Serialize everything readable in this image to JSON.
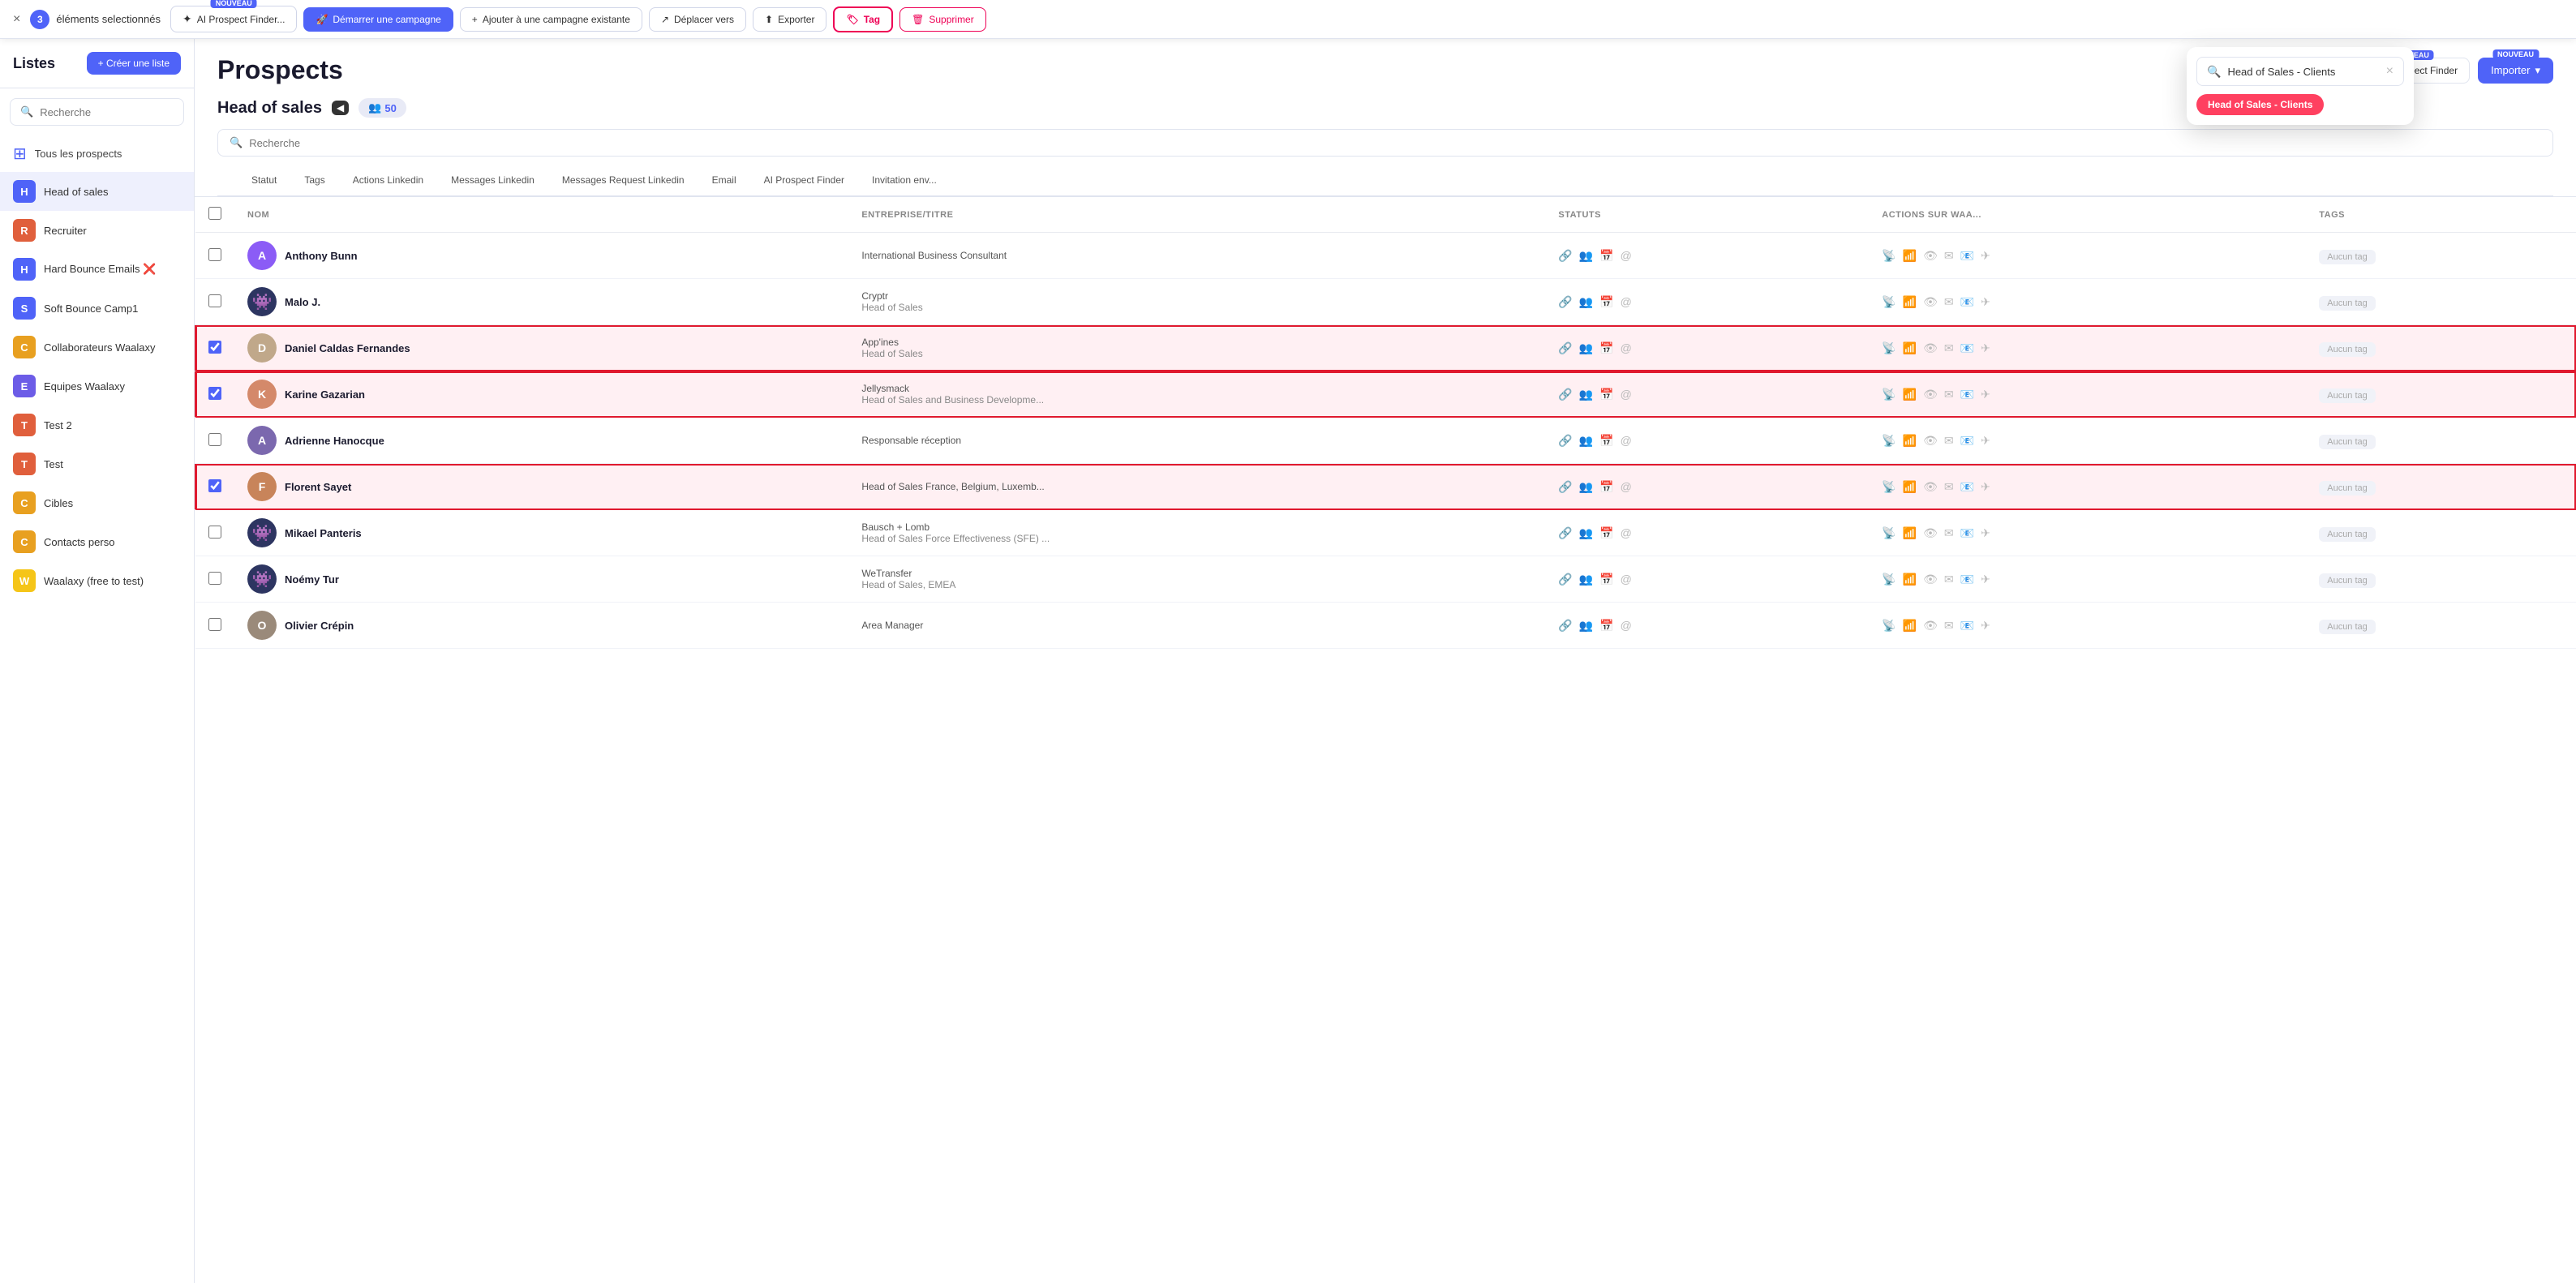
{
  "topbar": {
    "close_label": "×",
    "selected_count": "3",
    "selected_label": "éléments selectionnés",
    "ai_btn_label": "AI Prospect Finder...",
    "ai_btn_nouveau": "NOUVEAU",
    "campaign_btn": "Démarrer une campagne",
    "add_campaign_btn": "Ajouter à une campagne existante",
    "move_btn": "Déplacer vers",
    "export_btn": "Exporter",
    "tag_btn": "Tag",
    "delete_btn": "Supprimer"
  },
  "sidebar": {
    "title": "Listes",
    "create_btn": "+ Créer une liste",
    "search_placeholder": "Recherche",
    "all_label": "Tous les prospects",
    "lists": [
      {
        "id": "head-sales",
        "label": "Head of sales",
        "color": "#4f63f8",
        "letter": "H",
        "active": true
      },
      {
        "id": "recruiter",
        "label": "Recruiter",
        "color": "#e05f3c",
        "letter": "R"
      },
      {
        "id": "hard-bounce",
        "label": "Hard Bounce Emails ❌",
        "color": "#4f63f8",
        "letter": "H"
      },
      {
        "id": "soft-bounce",
        "label": "Soft Bounce Camp1",
        "color": "#4f63f8",
        "letter": "S"
      },
      {
        "id": "collaborateurs",
        "label": "Collaborateurs Waalaxy",
        "color": "#e8a020",
        "letter": "C"
      },
      {
        "id": "equipes",
        "label": "Equipes Waalaxy",
        "color": "#6c5ce7",
        "letter": "E"
      },
      {
        "id": "test2",
        "label": "Test 2",
        "color": "#e05f3c",
        "letter": "T"
      },
      {
        "id": "test",
        "label": "Test",
        "color": "#e05f3c",
        "letter": "T"
      },
      {
        "id": "cibles",
        "label": "Cibles",
        "color": "#e8a020",
        "letter": "C"
      },
      {
        "id": "contacts-perso",
        "label": "Contacts perso",
        "color": "#e8a020",
        "letter": "C"
      },
      {
        "id": "waalaxy-free",
        "label": "Waalaxy (free to test)",
        "color": "#f5c518",
        "letter": "W"
      }
    ]
  },
  "main": {
    "page_title": "Prospects",
    "list_name": "Head of sales",
    "count": "50",
    "count_icon": "👥",
    "search_placeholder": "Recherche",
    "import_btn": "Importer",
    "import_nouveau": "NOUVEAU",
    "prospect_finder_btn": "AI Prospect Finder",
    "prospect_finder_nouveau": "NOUVEAU",
    "filter_tabs": [
      "Statut",
      "Tags",
      "Actions Linkedin",
      "Messages Linkedin",
      "Messages Request Linkedin",
      "Email",
      "AI Prospect Finder",
      "Invitation env..."
    ],
    "table_headers": [
      "NOM",
      "ENTREPRISE/TITRE",
      "STATUTS",
      "ACTIONS SUR WAA...",
      "TAGS"
    ],
    "prospects": [
      {
        "id": 1,
        "name": "Anthony Bunn",
        "company": "International Business Consultant",
        "job": "",
        "selected": false,
        "avatar_type": "img",
        "avatar_bg": "#8b5cf6",
        "avatar_letter": "A"
      },
      {
        "id": 2,
        "name": "Malo J.",
        "company": "Cryptr",
        "job": "Head of Sales",
        "selected": false,
        "avatar_type": "alien",
        "avatar_bg": "#4f63f8"
      },
      {
        "id": 3,
        "name": "Daniel Caldas Fernandes",
        "company": "App'ines",
        "job": "Head of Sales",
        "selected": true,
        "avatar_type": "photo",
        "avatar_bg": "#c0a88a"
      },
      {
        "id": 4,
        "name": "Karine Gazarian",
        "company": "Jellysmack",
        "job": "Head of Sales and Business Developme...",
        "selected": true,
        "avatar_type": "photo",
        "avatar_bg": "#d4896a"
      },
      {
        "id": 5,
        "name": "Adrienne Hanocque",
        "company": "Responsable réception",
        "job": "",
        "selected": false,
        "avatar_type": "photo",
        "avatar_bg": "#7b68ae"
      },
      {
        "id": 6,
        "name": "Florent Sayet",
        "company": "Head of Sales France, Belgium, Luxemb...",
        "job": "",
        "selected": true,
        "avatar_type": "photo",
        "avatar_bg": "#c8845a"
      },
      {
        "id": 7,
        "name": "Mikael Panteris",
        "company": "Bausch + Lomb",
        "job": "Head of Sales Force Effectiveness (SFE) ...",
        "selected": false,
        "avatar_type": "alien",
        "avatar_bg": "#4f63f8"
      },
      {
        "id": 8,
        "name": "Noémy Tur",
        "company": "WeTransfer",
        "job": "Head of Sales, EMEA",
        "selected": false,
        "avatar_type": "alien",
        "avatar_bg": "#4f63f8"
      },
      {
        "id": 9,
        "name": "Olivier Crépin",
        "company": "Area Manager",
        "job": "",
        "selected": false,
        "avatar_type": "photo",
        "avatar_bg": "#9a8a7a"
      }
    ],
    "no_tag_label": "Aucun tag"
  },
  "tag_popup": {
    "search_value": "Head of Sales - Clients",
    "clear_icon": "×",
    "chip_label": "Head of Sales - Clients"
  },
  "colors": {
    "primary": "#4f63f8",
    "danger": "#e0192e",
    "selected_bg": "#fff0f3"
  }
}
